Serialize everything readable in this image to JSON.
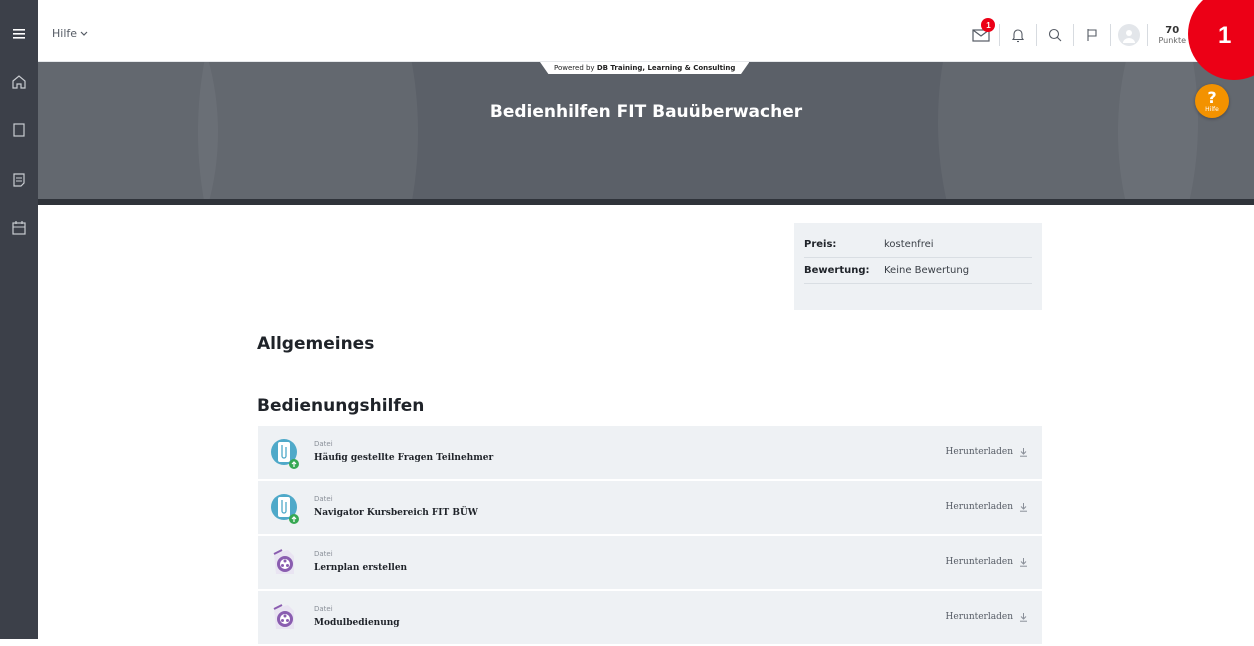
{
  "header": {
    "menu_label": "Hilfe",
    "mail_count": "1",
    "points_value": "70",
    "points_label": "Punkte",
    "step_number": "1"
  },
  "hero": {
    "powered_prefix": "Powered by",
    "powered_brand": "DB Training, Learning & Consulting",
    "title": "Bedienhilfen FIT Bauüberwacher",
    "help_q": "?",
    "help_label": "Hilfe"
  },
  "info": {
    "rows": [
      {
        "key": "Preis:",
        "value": "kostenfrei"
      },
      {
        "key": "Bewertung:",
        "value": "Keine Bewertung"
      }
    ]
  },
  "sections": {
    "general": "Allgemeines",
    "help": "Bedienungshilfen"
  },
  "items": [
    {
      "type": "Datei",
      "title": "Häufig gestellte Fragen Teilnehmer",
      "action": "Herunterladen",
      "icon": "paperclip-file-icon"
    },
    {
      "type": "Datei",
      "title": "Navigator Kursbereich FIT BÜW",
      "action": "Herunterladen",
      "icon": "paperclip-file-icon"
    },
    {
      "type": "Datei",
      "title": "Lernplan erstellen",
      "action": "Herunterladen",
      "icon": "video-file-icon"
    },
    {
      "type": "Datei",
      "title": "Modulbedienung",
      "action": "Herunterladen",
      "icon": "video-file-icon"
    }
  ],
  "colors": {
    "accent_red": "#ec0016",
    "help_orange": "#f39200",
    "rail": "#3c4049",
    "hero": "#5b6068"
  }
}
